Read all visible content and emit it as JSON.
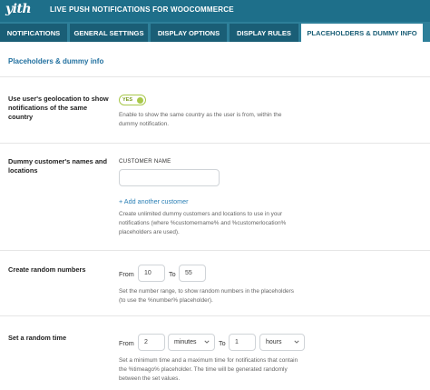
{
  "header": {
    "logo_text": "yith",
    "title": "LIVE PUSH NOTIFICATIONS FOR WOOCOMMERCE"
  },
  "tabs": [
    {
      "label": "NOTIFICATIONS",
      "active": false
    },
    {
      "label": "GENERAL SETTINGS",
      "active": false
    },
    {
      "label": "DISPLAY OPTIONS",
      "active": false
    },
    {
      "label": "DISPLAY RULES",
      "active": false
    },
    {
      "label": "PLACEHOLDERS & DUMMY INFO",
      "active": true
    }
  ],
  "section": {
    "title": "Placeholders & dummy info"
  },
  "geolocation": {
    "label": "Use user's geolocation to show notifications of the same country",
    "toggle_label": "YES",
    "toggle_on": true,
    "description": "Enable to show the same country as the user is from, within the dummy notification."
  },
  "dummy_customers": {
    "label": "Dummy customer's names and locations",
    "column_header": "CUSTOMER NAME",
    "name_value": "",
    "add_link": "+ Add another customer",
    "description": "Create unlimited dummy customers and locations to use in your notifications (where %customername% and %customerlocation% placeholders are used)."
  },
  "random_numbers": {
    "label": "Create random numbers",
    "from_label": "From",
    "from_value": "10",
    "to_label": "To",
    "to_value": "55",
    "description": "Set the number range, to show random numbers in the placeholders (to use the %number% placeholder)."
  },
  "random_time": {
    "label": "Set a random time",
    "from_label": "From",
    "from_value": "2",
    "from_unit": "minutes",
    "to_label": "To",
    "to_value": "1",
    "to_unit": "hours",
    "description": "Set a minimum time and a maximum time for notifications that contain the %timeago% placeholder. The time will be generated randomly between the set values."
  },
  "colors": {
    "header_bg": "#1e6f8a",
    "tabbar_bg": "#2d7f99",
    "tab_bg": "#1a5e76",
    "accent": "#2271a0",
    "toggle_on": "#a8c84a",
    "link": "#2a7fb5"
  }
}
